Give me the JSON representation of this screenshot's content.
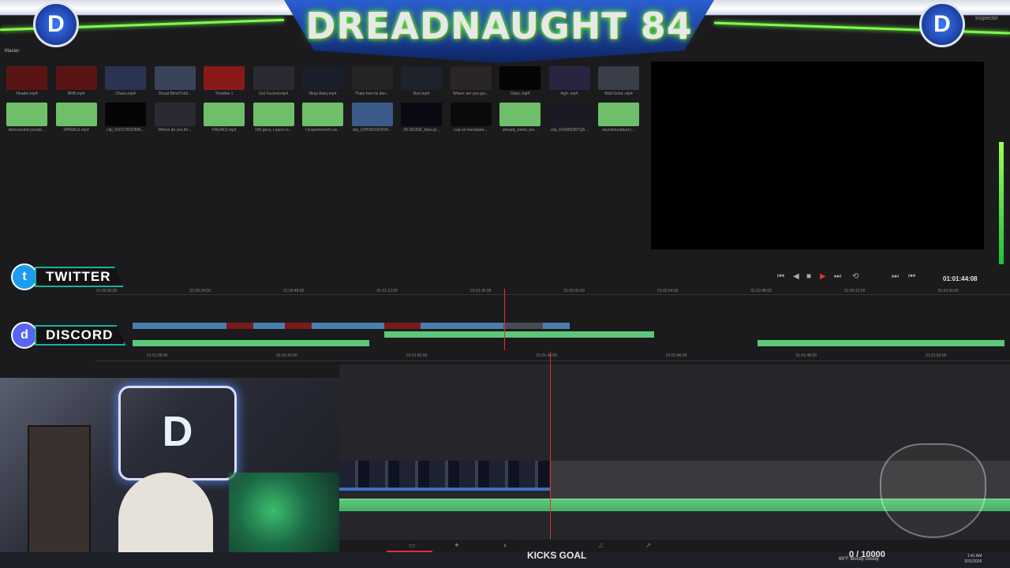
{
  "banner": {
    "title": "DREADNAUGHT 84",
    "right_small": "Inspector"
  },
  "media_pool": {
    "label": "Master",
    "row1": [
      {
        "name": "Header.mp4",
        "color": "#5a1414"
      },
      {
        "name": "BRB.mp4",
        "color": "#5a1414"
      },
      {
        "name": "Chaos.mp4",
        "color": "#2a3450"
      },
      {
        "name": "Dread Blind Fold...",
        "color": "#3a4458"
      },
      {
        "name": "Timeline 1",
        "color": "#8a1a1a"
      },
      {
        "name": "Get Fucked.mp4",
        "color": "#2a2a32"
      },
      {
        "name": "Ninja Baby.mp4",
        "color": "#1a1e2a"
      },
      {
        "name": "Thats how its don...",
        "color": "#242424"
      },
      {
        "name": "Run.mp4",
        "color": "#1e222c"
      },
      {
        "name": "Where are you goi...",
        "color": "#2a2626"
      },
      {
        "name": "Oops..mp4",
        "color": "#050505"
      },
      {
        "name": "high..mp4",
        "color": "#2a2440"
      },
      {
        "name": "Wall Grind..mp4",
        "color": "#3a3e48"
      }
    ],
    "row2": [
      {
        "name": "deloxsound-youtub...",
        "color": "#6fbf6a"
      },
      {
        "name": "SPIRALS.mp3",
        "color": "#6fbf6a"
      },
      {
        "name": "clip_01KSTR2DMN...",
        "color": "#050505"
      },
      {
        "name": "Where do you thi...",
        "color": "#2a2a32"
      },
      {
        "name": "FREAKS.mp3",
        "color": "#6fbf6a"
      },
      {
        "name": "100 gecs, Laura Le...",
        "color": "#6fbf6a"
      },
      {
        "name": "I Experienced Lov...",
        "color": "#6fbf6a"
      },
      {
        "name": "clip_01HV6DSF8VR...",
        "color": "#3a5a8a"
      },
      {
        "name": "28-281536_blue-pi...",
        "color": "#0a0a14"
      },
      {
        "name": "cup-on-transpare...",
        "color": "#0a0a0a"
      },
      {
        "name": "already_knew_wo...",
        "color": "#6fbf6a"
      },
      {
        "name": "clip_01KM9GBTQ8...",
        "color": "#1a1a24"
      },
      {
        "name": "soundcloudaud.c...",
        "color": "#6fbf6a"
      }
    ]
  },
  "viewer": {
    "timecode": "01:01:44:08"
  },
  "overlay": {
    "twitter": "TWITTER",
    "discord": "DISCORD"
  },
  "upper_ruler": [
    "01:00:00:00",
    "01:00:24:00",
    "01:00:48:00",
    "01:01:12:00",
    "01:01:36:00",
    "01:02:00:00",
    "01:02:24:00",
    "01:02:48:00",
    "01:03:12:00",
    "01:03:36:00"
  ],
  "lower_ruler": [
    "01:01:38:00",
    "01:01:40:00",
    "01:01:42:00",
    "01:01:44:00",
    "01:01:46:00",
    "01:01:48:00",
    "01:01:50:00"
  ],
  "stream": {
    "caption": "KICKS GOAL",
    "goal": "0 / 10000"
  },
  "taskbar": {
    "weather": "69°F Mostly cloudy",
    "time": "1:41 AM",
    "date": "3/31/2026"
  },
  "colors": {
    "accent": "#e03030",
    "audio": "#5dc77a",
    "video": "#3e6fc8"
  }
}
